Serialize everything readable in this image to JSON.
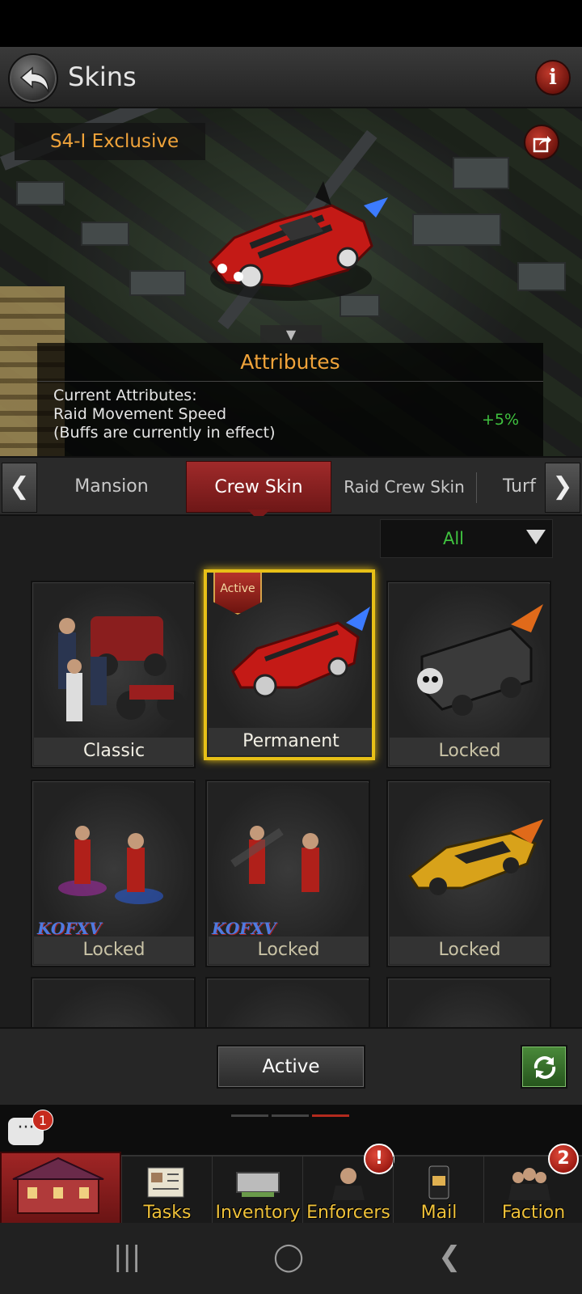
{
  "header": {
    "title": "Skins",
    "info_glyph": "i"
  },
  "preview": {
    "exclusive_tag": "S4-I Exclusive",
    "attributes": {
      "title": "Attributes",
      "line1": "Current Attributes:",
      "line2": "Raid Movement Speed",
      "line3": "(Buffs are currently in effect)",
      "value": "+5%"
    }
  },
  "tabs": {
    "prev_glyph": "❮",
    "next_glyph": "❯",
    "items": [
      {
        "label": "Mansion"
      },
      {
        "label": "Crew Skin"
      },
      {
        "label": "Raid Crew Skin"
      },
      {
        "label": "Turf"
      }
    ],
    "active_index": 1
  },
  "filter": {
    "selected": "All"
  },
  "skins": [
    {
      "label": "Classic",
      "status": "owned"
    },
    {
      "label": "Permanent",
      "status": "selected",
      "badge": "Active"
    },
    {
      "label": "Locked",
      "status": "locked"
    },
    {
      "label": "Locked",
      "status": "locked",
      "logo": "KOFXV"
    },
    {
      "label": "Locked",
      "status": "locked",
      "logo": "KOFXV"
    },
    {
      "label": "Locked",
      "status": "locked"
    }
  ],
  "actions": {
    "active_label": "Active"
  },
  "chat": {
    "badge": "1",
    "glyph": "···"
  },
  "bottom_nav": {
    "tasks": "Tasks",
    "inventory": "Inventory",
    "enforcers": "Enforcers",
    "enforcers_badge": "!",
    "mail": "Mail",
    "faction": "Faction",
    "faction_badge": "2"
  },
  "system_nav": {
    "recents": "|||",
    "home": "◯",
    "back": "❮"
  },
  "colors": {
    "accent_red": "#a02a2a",
    "gold": "#e7c017",
    "green": "#3fc23f",
    "orange": "#f0a33a"
  }
}
